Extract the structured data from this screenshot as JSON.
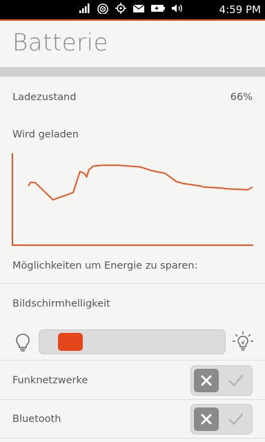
{
  "status_bar": {
    "time": "4:59 PM",
    "icons": [
      "signal-icon",
      "wifi-icon",
      "location-icon",
      "mail-icon",
      "battery-icon",
      "volume-icon"
    ]
  },
  "header": {
    "title": "Batterie"
  },
  "charge": {
    "label": "Ladezustand",
    "value": "66%"
  },
  "charging": {
    "label": "Wird geladen",
    "chart_data": {
      "type": "line",
      "title": "",
      "xlabel": "",
      "ylabel": "",
      "line_color": "#e95420",
      "x": [
        0,
        1,
        3,
        11,
        20,
        23,
        25,
        26,
        27,
        29,
        33,
        40,
        45,
        50,
        55,
        61,
        66,
        69,
        77,
        78,
        86,
        89,
        98,
        100
      ],
      "y": [
        64,
        68,
        68,
        49,
        57,
        80,
        78,
        74,
        82,
        86,
        87,
        87,
        86,
        85,
        81,
        78,
        69,
        67,
        64,
        63,
        62,
        61,
        60,
        63
      ],
      "xlim": [
        0,
        100
      ],
      "ylim": [
        0,
        100
      ]
    }
  },
  "saving": {
    "label": "Möglichkeiten um Energie zu sparen:"
  },
  "brightness": {
    "label": "Bildschirmhelligkeit",
    "level": 0.1,
    "low_icon": "bulb-dim-icon",
    "high_icon": "bulb-bright-icon"
  },
  "toggles": [
    {
      "label": "Funknetzwerke",
      "state": "off"
    },
    {
      "label": "Bluetooth",
      "state": "off"
    }
  ],
  "colors": {
    "accent": "#e95420",
    "slider_thumb": "#e4471a"
  }
}
